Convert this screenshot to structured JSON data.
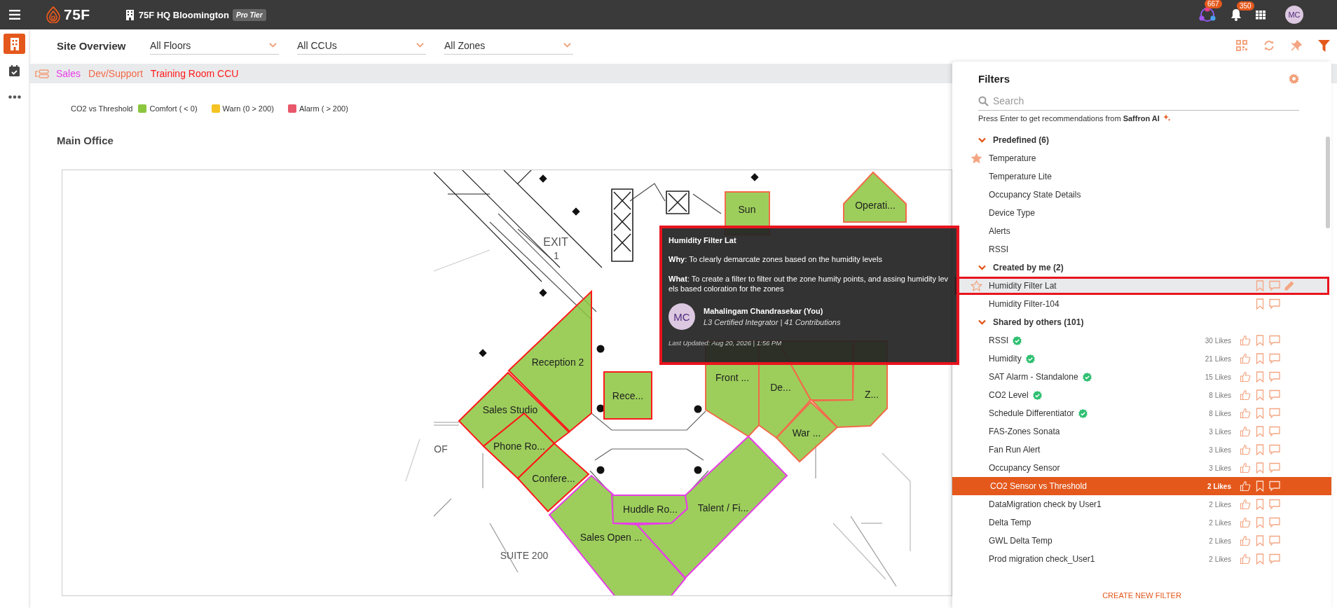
{
  "top_bar": {
    "logo_text": "75F",
    "site_name": "75F HQ Bloomington",
    "tier": "Pro Tier",
    "community_count": "667",
    "notification_count": "350",
    "avatar_initials": "MC"
  },
  "nav": [
    {
      "kind": "building",
      "selected": true
    },
    {
      "kind": "calendar",
      "selected": false
    },
    {
      "kind": "more",
      "selected": false
    }
  ],
  "header": {
    "title": "Site Overview",
    "dropdowns": [
      {
        "value": "All Floors"
      },
      {
        "value": "All CCUs"
      },
      {
        "value": "All Zones"
      }
    ],
    "tools": [
      {
        "kind": "qr",
        "selected": false
      },
      {
        "kind": "refresh",
        "selected": false
      },
      {
        "kind": "pin",
        "selected": false
      },
      {
        "kind": "filter",
        "selected": true
      }
    ]
  },
  "ccus": [
    {
      "name": "Sales",
      "color": "#e83ee8"
    },
    {
      "name": "Dev/Support",
      "color": "#f26b4a"
    },
    {
      "name": "Training Room CCU",
      "color": "#ff1a1a"
    }
  ],
  "legend": {
    "title": "CO2 vs Threshold",
    "items": [
      {
        "label": "Comfort ( < 0)",
        "color": "#8cc63f"
      },
      {
        "label": "Warn (0 > 200)",
        "color": "#f5c323"
      },
      {
        "label": "Alarm ( > 200)",
        "color": "#e8586a"
      }
    ]
  },
  "floor": {
    "title": "Main Office",
    "plan_labels": [
      {
        "text": "EXIT"
      },
      {
        "text": "1"
      },
      {
        "text": "OF"
      },
      {
        "text": "SUITE 200"
      }
    ],
    "zones": [
      {
        "label": "Sun",
        "color": "#f26b4a"
      },
      {
        "label": "Operati...",
        "color": "#f26b4a"
      },
      {
        "label": "Reception 2",
        "color": "#ff1a1a"
      },
      {
        "label": "Rece...",
        "color": "#ff1a1a"
      },
      {
        "label": "Sales Studio",
        "color": "#ff1a1a"
      },
      {
        "label": "Phone Ro...",
        "color": "#ff1a1a"
      },
      {
        "label": "Confere...",
        "color": "#ff1a1a"
      },
      {
        "label": "Front ...",
        "color": "#f26b4a"
      },
      {
        "label": "De...",
        "color": "#f26b4a"
      },
      {
        "color": "#f26b4a"
      },
      {
        "label": "Z...",
        "color": "#f26b4a"
      },
      {
        "label": "War ...",
        "color": "#f26b4a"
      },
      {
        "label": "Sales Open ...",
        "color": "#e83ee8"
      },
      {
        "label": "Huddle Ro...",
        "color": "#e83ee8"
      },
      {
        "label": "Talent / Fi...",
        "color": "#e83ee8"
      }
    ]
  },
  "tooltip": {
    "title": "Humidity Filter Lat",
    "why": "**Why**: To clearly demarcate zones based on the humidity levels",
    "what": "**What**: To create a filter to filter out the zone humity points, and assing humidity levels based coloration for the zones",
    "author": {
      "initials": "MC",
      "name": "Mahalingam Chandrasekar  (You)",
      "meta": "L3 Certified Integrator | 41 Contributions"
    },
    "updated": "Last Updated: Aug 20, 2026 | 1:56 PM"
  },
  "filters": {
    "title": "Filters",
    "search_placeholder": "Search",
    "hint": "Press Enter to get recommendations from **Saffron AI**",
    "create_label": "CREATE NEW FILTER",
    "sections": [
      {
        "title": "Predefined (6)",
        "expanded": true,
        "items": [
          {
            "name": "Temperature",
            "kind": "predefined",
            "favorite": true,
            "selected": false,
            "hovered": false
          },
          {
            "name": "Temperature Lite",
            "kind": "predefined",
            "favorite": false,
            "selected": false,
            "hovered": false
          },
          {
            "name": "Occupancy State Details",
            "kind": "predefined",
            "favorite": false,
            "selected": false,
            "hovered": false
          },
          {
            "name": "Device Type",
            "kind": "predefined",
            "favorite": false,
            "selected": false,
            "hovered": false
          },
          {
            "name": "Alerts",
            "kind": "predefined",
            "favorite": false,
            "selected": false,
            "hovered": false
          },
          {
            "name": "RSSI",
            "kind": "predefined",
            "favorite": false,
            "selected": false,
            "hovered": false
          }
        ]
      },
      {
        "title": "Created by me (2)",
        "expanded": true,
        "items": [
          {
            "name": "Humidity Filter Lat",
            "kind": "own",
            "favorite": false,
            "editable": true,
            "selected": false,
            "hovered": true
          },
          {
            "name": "Humidity Filter-104",
            "kind": "own",
            "favorite": false,
            "editable": false,
            "selected": false,
            "hovered": false
          }
        ]
      },
      {
        "title": "Shared by others (101)",
        "expanded": true,
        "items": [
          {
            "name": "RSSI",
            "kind": "shared",
            "verified": true,
            "likes": "30 Likes",
            "selected": false,
            "hovered": false
          },
          {
            "name": "Humidity",
            "kind": "shared",
            "verified": true,
            "likes": "21 Likes",
            "selected": false,
            "hovered": false
          },
          {
            "name": "SAT Alarm - Standalone",
            "kind": "shared",
            "verified": true,
            "likes": "15 Likes",
            "selected": false,
            "hovered": false
          },
          {
            "name": "CO2 Level",
            "kind": "shared",
            "verified": true,
            "likes": "8 Likes",
            "selected": false,
            "hovered": false
          },
          {
            "name": "Schedule Differentiator",
            "kind": "shared",
            "verified": true,
            "likes": "8 Likes",
            "selected": false,
            "hovered": false
          },
          {
            "name": "FAS-Zones Sonata",
            "kind": "shared",
            "verified": false,
            "likes": "3 Likes",
            "selected": false,
            "hovered": false
          },
          {
            "name": "Fan Run Alert",
            "kind": "shared",
            "verified": false,
            "likes": "3 Likes",
            "selected": false,
            "hovered": false
          },
          {
            "name": "Occupancy Sensor",
            "kind": "shared",
            "verified": false,
            "likes": "3 Likes",
            "selected": false,
            "hovered": false
          },
          {
            "name": "CO2 Sensor vs Threshold",
            "kind": "shared",
            "verified": false,
            "likes": "2 Likes",
            "selected": true,
            "hovered": false
          },
          {
            "name": "DataMigration check by User1",
            "kind": "shared",
            "verified": false,
            "likes": "2 Likes",
            "selected": false,
            "hovered": false
          },
          {
            "name": "Delta Temp",
            "kind": "shared",
            "verified": false,
            "likes": "2 Likes",
            "selected": false,
            "hovered": false
          },
          {
            "name": "GWL Delta Temp",
            "kind": "shared",
            "verified": false,
            "likes": "2 Likes",
            "selected": false,
            "hovered": false
          },
          {
            "name": "Prod migration check_User1",
            "kind": "shared",
            "verified": false,
            "likes": "2 Likes",
            "selected": false,
            "hovered": false
          }
        ]
      }
    ]
  }
}
